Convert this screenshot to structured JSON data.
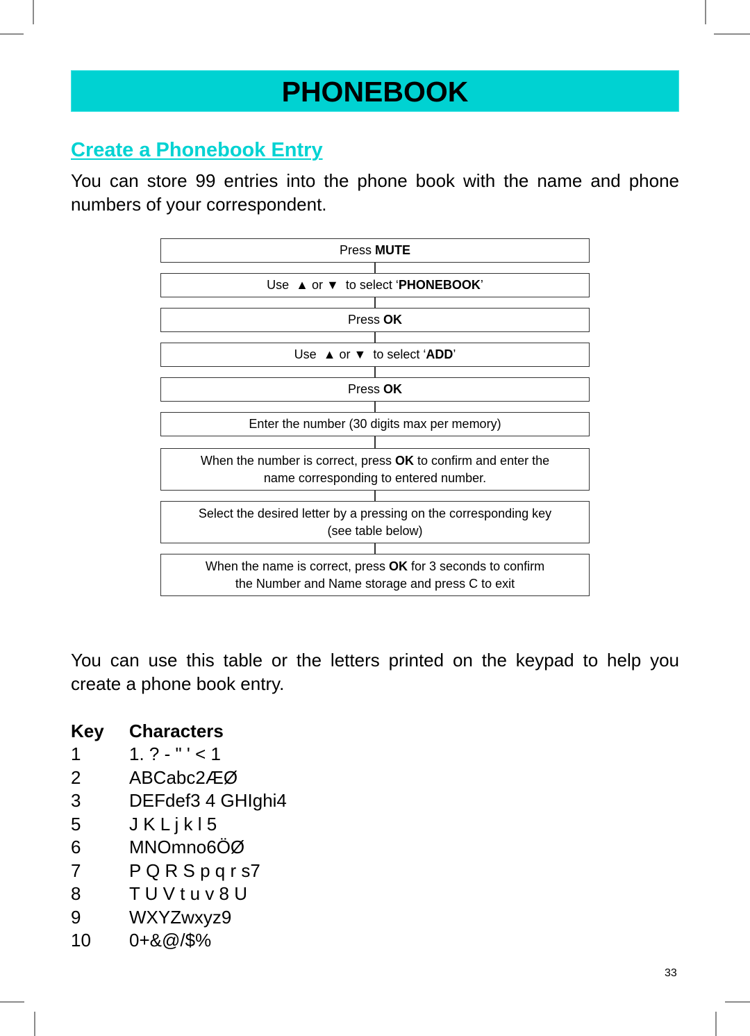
{
  "banner": {
    "title": "PHONEBOOK"
  },
  "section": {
    "title": "Create a Phonebook Entry"
  },
  "intro": "You can store 99 entries into the phone book with the name and phone numbers of your correspondent.",
  "flow": {
    "arrow_up": "▲",
    "arrow_down": "▼",
    "steps": [
      {
        "pre": "Press ",
        "bold": "MUTE",
        "post": ""
      },
      {
        "pre": "Use ",
        "mid": " or ",
        "post_arrow": " to select ‘",
        "bold": "PHONEBOOK",
        "post": "’"
      },
      {
        "pre": "Press ",
        "bold": "OK",
        "post": ""
      },
      {
        "pre": "Use ",
        "mid": " or ",
        "post_arrow": " to select ‘",
        "bold": "ADD",
        "post": "’"
      },
      {
        "pre": "Press ",
        "bold": "OK",
        "post": ""
      },
      {
        "text": "Enter the number (30 digits max per memory)"
      },
      {
        "pre": "When the number is correct, press ",
        "bold": "OK",
        "post": " to confirm and enter the",
        "line2": "name corresponding to entered number."
      },
      {
        "line1": "Select the desired letter by a pressing on the corresponding key",
        "line2": "(see table below)"
      },
      {
        "pre": "When the name is correct, press ",
        "bold": "OK",
        "post": " for 3 seconds to confirm",
        "line2": "the Number and Name storage and press C to exit"
      }
    ]
  },
  "table_intro": "You can use this table or the letters printed on the keypad to help you create a phone book entry.",
  "key_table": {
    "headers": [
      "Key",
      "Characters"
    ],
    "rows": [
      {
        "key": "1",
        "chars": "1. ? - \" ' < 1"
      },
      {
        "key": "2",
        "chars": "ABCabc2ÆØ"
      },
      {
        "key": "3",
        "chars": "DEFdef3 4 GHIghi4"
      },
      {
        "key": "5",
        "chars": "J K L j k l 5"
      },
      {
        "key": "6",
        "chars": "MNOmno6ÖØ"
      },
      {
        "key": "7",
        "chars": "P Q R S p q r s7"
      },
      {
        "key": "8",
        "chars": "T U V t u v 8 U"
      },
      {
        "key": "9",
        "chars": "WXYZwxyz9"
      },
      {
        "key": "10",
        "chars": "0+&@/$%"
      }
    ]
  },
  "page_number": "33",
  "colors": {
    "accent": "#00d2d2"
  }
}
